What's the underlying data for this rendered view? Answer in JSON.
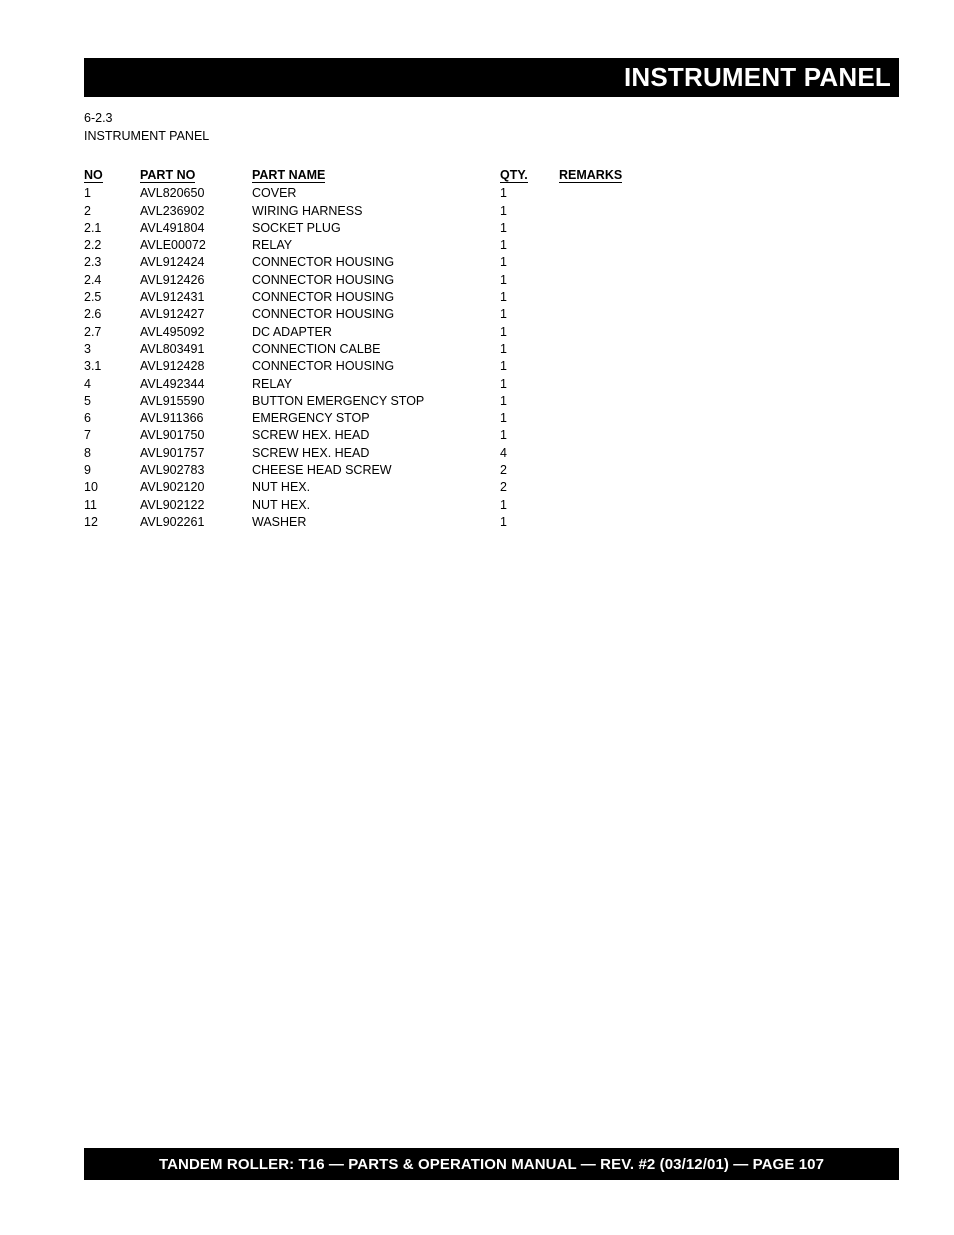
{
  "header": {
    "title": "INSTRUMENT PANEL"
  },
  "section": {
    "number": "6-2.3",
    "name": "INSTRUMENT PANEL"
  },
  "table": {
    "columns": [
      "NO",
      "PART NO",
      "PART NAME",
      "QTY.",
      "REMARKS"
    ],
    "rows": [
      {
        "no": "1",
        "part_no": "AVL820650",
        "part_name": "COVER",
        "qty": "1",
        "remarks": ""
      },
      {
        "no": "2",
        "part_no": "AVL236902",
        "part_name": "WIRING HARNESS",
        "qty": "1",
        "remarks": ""
      },
      {
        "no": "2.1",
        "part_no": "AVL491804",
        "part_name": "SOCKET PLUG",
        "qty": "1",
        "remarks": ""
      },
      {
        "no": "2.2",
        "part_no": "AVLE00072",
        "part_name": "RELAY",
        "qty": "1",
        "remarks": ""
      },
      {
        "no": "2.3",
        "part_no": "AVL912424",
        "part_name": "CONNECTOR HOUSING",
        "qty": "1",
        "remarks": ""
      },
      {
        "no": "2.4",
        "part_no": "AVL912426",
        "part_name": "CONNECTOR HOUSING",
        "qty": "1",
        "remarks": ""
      },
      {
        "no": "2.5",
        "part_no": "AVL912431",
        "part_name": "CONNECTOR HOUSING",
        "qty": "1",
        "remarks": ""
      },
      {
        "no": "2.6",
        "part_no": "AVL912427",
        "part_name": "CONNECTOR HOUSING",
        "qty": "1",
        "remarks": ""
      },
      {
        "no": "2.7",
        "part_no": "AVL495092",
        "part_name": "DC ADAPTER",
        "qty": "1",
        "remarks": ""
      },
      {
        "no": "3",
        "part_no": "AVL803491",
        "part_name": "CONNECTION CALBE",
        "qty": "1",
        "remarks": ""
      },
      {
        "no": "3.1",
        "part_no": "AVL912428",
        "part_name": "CONNECTOR HOUSING",
        "qty": "1",
        "remarks": ""
      },
      {
        "no": "4",
        "part_no": "AVL492344",
        "part_name": "RELAY",
        "qty": "1",
        "remarks": ""
      },
      {
        "no": "5",
        "part_no": "AVL915590",
        "part_name": "BUTTON EMERGENCY STOP",
        "qty": "1",
        "remarks": ""
      },
      {
        "no": "6",
        "part_no": "AVL911366",
        "part_name": "EMERGENCY STOP",
        "qty": "1",
        "remarks": ""
      },
      {
        "no": "7",
        "part_no": "AVL901750",
        "part_name": "SCREW HEX. HEAD",
        "qty": "1",
        "remarks": ""
      },
      {
        "no": "8",
        "part_no": "AVL901757",
        "part_name": "SCREW HEX. HEAD",
        "qty": "4",
        "remarks": ""
      },
      {
        "no": "9",
        "part_no": "AVL902783",
        "part_name": "CHEESE HEAD SCREW",
        "qty": "2",
        "remarks": ""
      },
      {
        "no": "10",
        "part_no": "AVL902120",
        "part_name": "NUT HEX.",
        "qty": "2",
        "remarks": ""
      },
      {
        "no": "11",
        "part_no": "AVL902122",
        "part_name": "NUT HEX.",
        "qty": "1",
        "remarks": ""
      },
      {
        "no": "12",
        "part_no": "AVL902261",
        "part_name": "WASHER",
        "qty": "1",
        "remarks": ""
      }
    ]
  },
  "footer": {
    "text": "TANDEM ROLLER: T16 — PARTS & OPERATION MANUAL — REV. #2 (03/12/01) — PAGE 107"
  }
}
